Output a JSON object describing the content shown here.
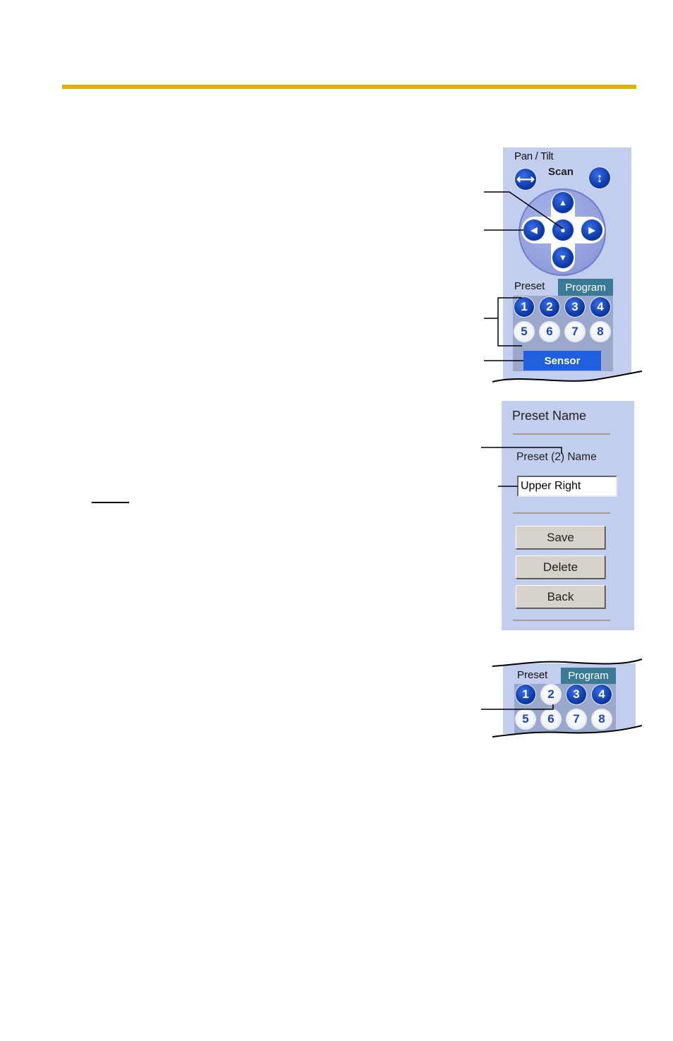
{
  "page": {
    "accent_bar_color": "#dcb400"
  },
  "pan_tilt_panel": {
    "title": "Pan / Tilt",
    "scan_label": "Scan",
    "scan_horizontal_icon": "horizontal-arrows-icon",
    "scan_vertical_icon": "vertical-arrows-icon",
    "dpad": {
      "up": "▲",
      "left": "◀",
      "center": "●",
      "right": "▶",
      "down": "▼"
    },
    "tabs": {
      "preset": "Preset",
      "program": "Program"
    },
    "presets": [
      {
        "label": "1",
        "state": "set"
      },
      {
        "label": "2",
        "state": "set"
      },
      {
        "label": "3",
        "state": "set"
      },
      {
        "label": "4",
        "state": "set"
      },
      {
        "label": "5",
        "state": "unset"
      },
      {
        "label": "6",
        "state": "unset"
      },
      {
        "label": "7",
        "state": "unset"
      },
      {
        "label": "8",
        "state": "unset"
      }
    ],
    "sensor_label": "Sensor"
  },
  "preset_name_panel": {
    "title": "Preset Name",
    "subtitle": "Preset (2) Name",
    "name_value": "Upper Right",
    "buttons": {
      "save": "Save",
      "delete": "Delete",
      "back": "Back"
    }
  },
  "preset_result_panel": {
    "tabs": {
      "preset": "Preset",
      "program": "Program"
    },
    "presets": [
      {
        "label": "1",
        "state": "set"
      },
      {
        "label": "2",
        "state": "unset"
      },
      {
        "label": "3",
        "state": "set"
      },
      {
        "label": "4",
        "state": "set"
      },
      {
        "label": "5",
        "state": "unset"
      },
      {
        "label": "6",
        "state": "unset"
      },
      {
        "label": "7",
        "state": "unset"
      },
      {
        "label": "8",
        "state": "unset"
      }
    ]
  }
}
